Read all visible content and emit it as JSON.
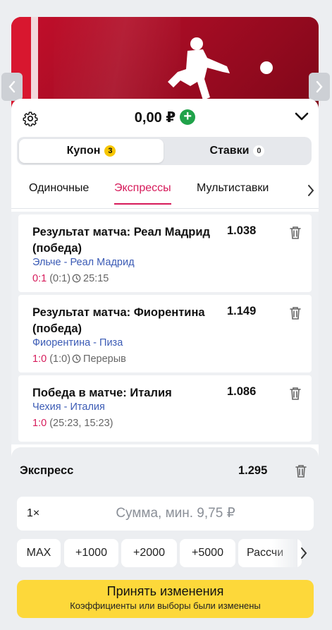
{
  "header": {
    "balance": "0,00 ₽"
  },
  "segment": {
    "coupon_label": "Купон",
    "coupon_count": "3",
    "bets_label": "Ставки",
    "bets_count": "0"
  },
  "bet_tabs": [
    "Одиночные",
    "Экспрессы",
    "Мультиставки"
  ],
  "selections": [
    {
      "title": "Результат матча: Реал Мадрид (победа)",
      "odd": "1.038",
      "match": "Эльче - Реал Мадрид",
      "score": "0:1",
      "period": "(0:1)",
      "time": "25:15"
    },
    {
      "title": "Результат матча: Фиорентина (победа)",
      "odd": "1.149",
      "match": "Фиорентина - Пиза",
      "score": "1:0",
      "period": "(1:0)",
      "time": "Перерыв"
    },
    {
      "title": "Победа в матче: Италия",
      "odd": "1.086",
      "match": "Чехия - Италия",
      "score": "1:0",
      "period": "(25:23, 15:23)"
    }
  ],
  "express": {
    "label": "Экспресс",
    "total_odd": "1.295",
    "multiplier": "1×",
    "amount_placeholder": "Сумма, мин. 9,75 ₽"
  },
  "quick_amounts": [
    "MAX",
    "+1000",
    "+2000",
    "+5000",
    "Рассчи"
  ],
  "accept": {
    "title": "Принять изменения",
    "subtitle": "Коэффициенты или выборы были изменены"
  },
  "colors": {
    "accent": "#d61a5a",
    "link": "#3b5bb5",
    "confirm": "#fdd83a",
    "positive": "#20a24a"
  }
}
